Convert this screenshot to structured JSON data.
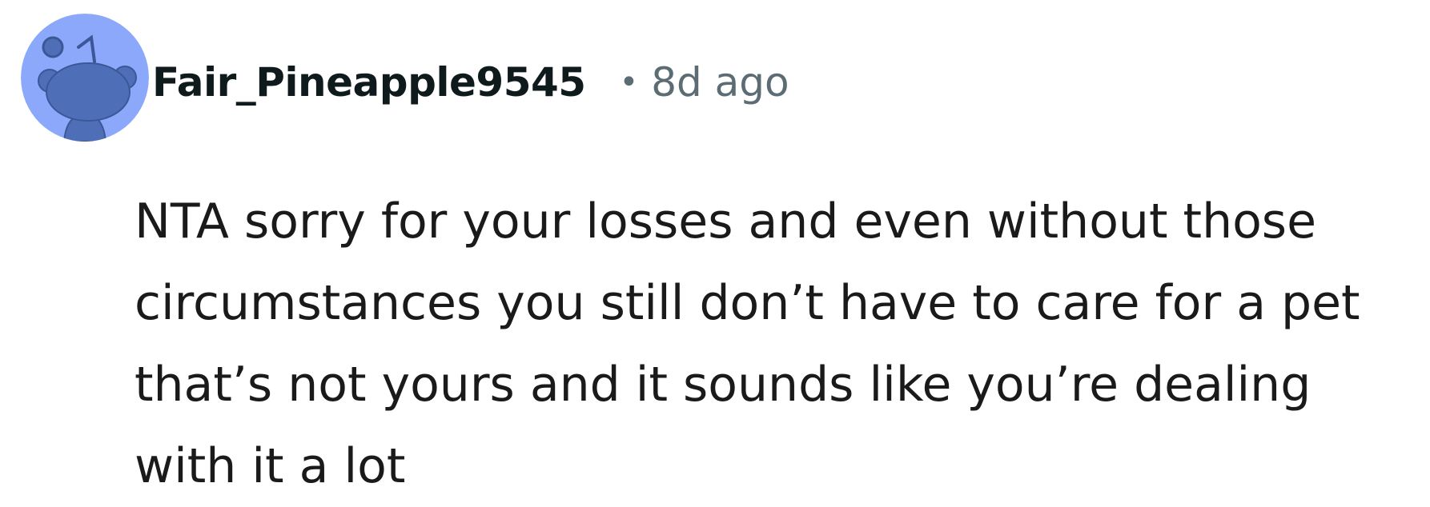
{
  "comment": {
    "author": "Fair_Pineapple9545",
    "separator": "•",
    "age": "8d ago",
    "body_lines": [
      "NTA sorry for your losses and even without those",
      "circumstances you still don’t have to care for a pet",
      "that’s not yours and it sounds like you’re dealing",
      "with it a lot"
    ],
    "avatar_icon": "snoo-avatar-icon",
    "colors": {
      "avatar_background": "#8ca8fb",
      "avatar_figure": "#4e6fb8",
      "username": "#0f1a1c",
      "meta": "#5c6c74",
      "body": "#1a1a1b"
    }
  }
}
